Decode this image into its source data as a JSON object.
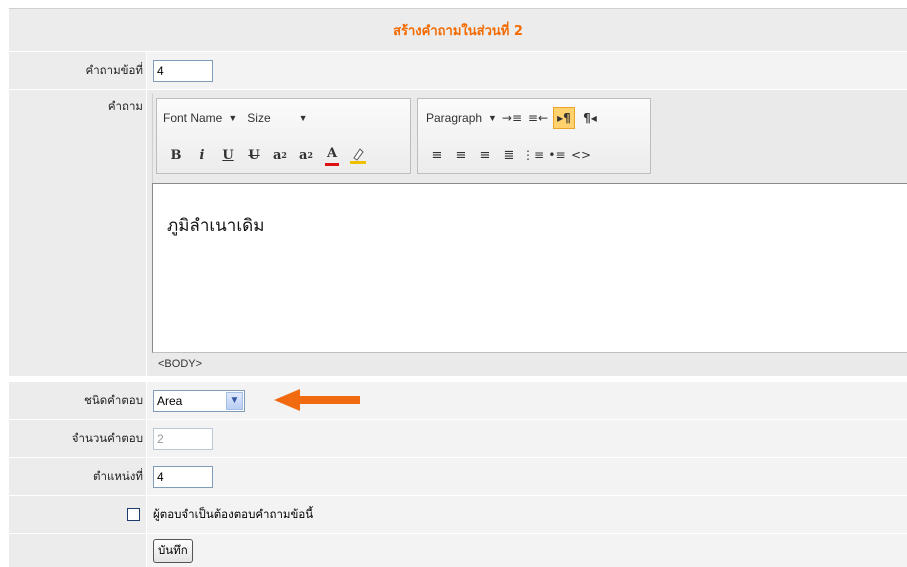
{
  "title": "สร้างคำถามในส่วนที่ 2",
  "fields": {
    "question_no": {
      "label": "คำถามข้อที่",
      "value": "4"
    },
    "question": {
      "label": "คำถาม"
    },
    "answer_type": {
      "label": "ชนิดคำตอบ",
      "value": "Area"
    },
    "answer_count": {
      "label": "จำนวนคำตอบ",
      "value": "2"
    },
    "position": {
      "label": "ตำแหน่งที่",
      "value": "4"
    },
    "required": {
      "label": "ผู้ตอบจำเป็นต้องตอบคำถามข้อนี้",
      "checked": false
    }
  },
  "editor": {
    "font_name": "Font Name",
    "size": "Size",
    "paragraph": "Paragraph",
    "content": "ภูมิลำเนาเดิม",
    "status": "<BODY>",
    "icons_row1_left": [
      "font-name-dropdown",
      "size-dropdown"
    ],
    "icons_row1_right": [
      "indent-icon",
      "outdent-icon",
      "rtl-paragraph-icon",
      "ltr-paragraph-icon"
    ],
    "icons_row2_left": [
      "bold-icon",
      "italic-icon",
      "underline-icon",
      "strikethrough-icon",
      "superscript-icon",
      "subscript-icon",
      "font-color-icon",
      "highlight-color-icon"
    ],
    "icons_row2_right": [
      "align-left-icon",
      "align-center-icon",
      "align-right-icon",
      "justify-icon",
      "numbered-list-icon",
      "bullet-list-icon",
      "html-source-icon"
    ]
  },
  "save_button": "บันทึก",
  "colors": {
    "title": "#f36b00",
    "arrow": "#f26a10",
    "label_bg": "#ececec",
    "value_bg": "#f3f3f3"
  }
}
